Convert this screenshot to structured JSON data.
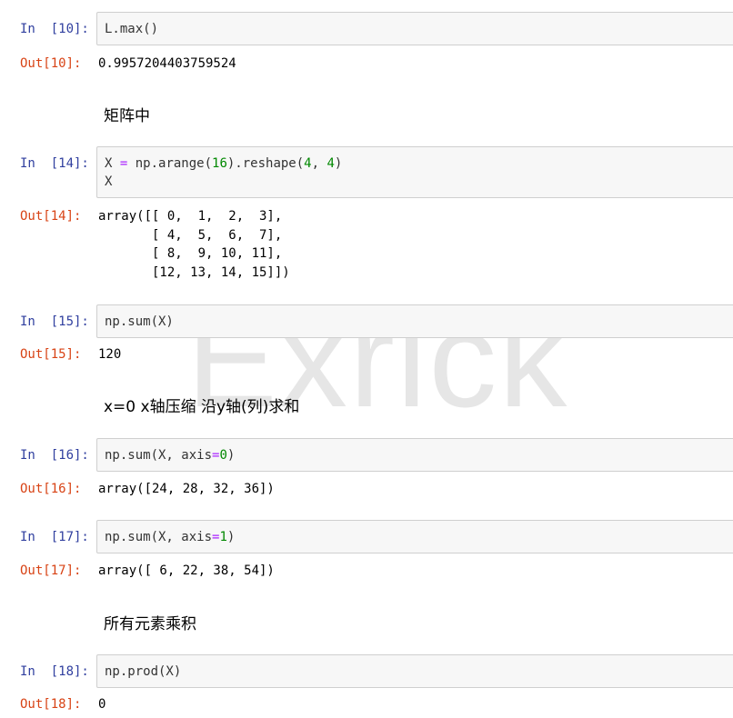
{
  "watermark": "Exrick",
  "cells": [
    {
      "in_prompt": "In  [10]:",
      "code": [
        "L.max()"
      ],
      "out_prompt": "Out[10]:",
      "output": "0.9957204403759524"
    },
    {
      "markdown": "矩阵中"
    },
    {
      "in_prompt": "In  [14]:",
      "code_line1": {
        "a": "X ",
        "eq": "=",
        "b": " np.arange(",
        "n1": "16",
        "c": ").reshape(",
        "n2": "4",
        "d": ", ",
        "n3": "4",
        "e": ")"
      },
      "code_line2": "X",
      "out_prompt": "Out[14]:",
      "output": "array([[ 0,  1,  2,  3],\n       [ 4,  5,  6,  7],\n       [ 8,  9, 10, 11],\n       [12, 13, 14, 15]])"
    },
    {
      "in_prompt": "In  [15]:",
      "code": [
        "np.sum(X)"
      ],
      "out_prompt": "Out[15]:",
      "output": "120"
    },
    {
      "markdown": "x=0 x轴压缩 沿y轴(列)求和"
    },
    {
      "in_prompt": "In  [16]:",
      "code_parts": {
        "a": "np.sum(X, axis",
        "eq": "=",
        "n": "0",
        "b": ")"
      },
      "out_prompt": "Out[16]:",
      "output": "array([24, 28, 32, 36])"
    },
    {
      "in_prompt": "In  [17]:",
      "code_parts": {
        "a": "np.sum(X, axis",
        "eq": "=",
        "n": "1",
        "b": ")"
      },
      "out_prompt": "Out[17]:",
      "output": "array([ 6, 22, 38, 54])"
    },
    {
      "markdown": "所有元素乘积"
    },
    {
      "in_prompt": "In  [18]:",
      "code": [
        "np.prod(X)"
      ],
      "out_prompt": "Out[18]:",
      "output": "0"
    }
  ]
}
